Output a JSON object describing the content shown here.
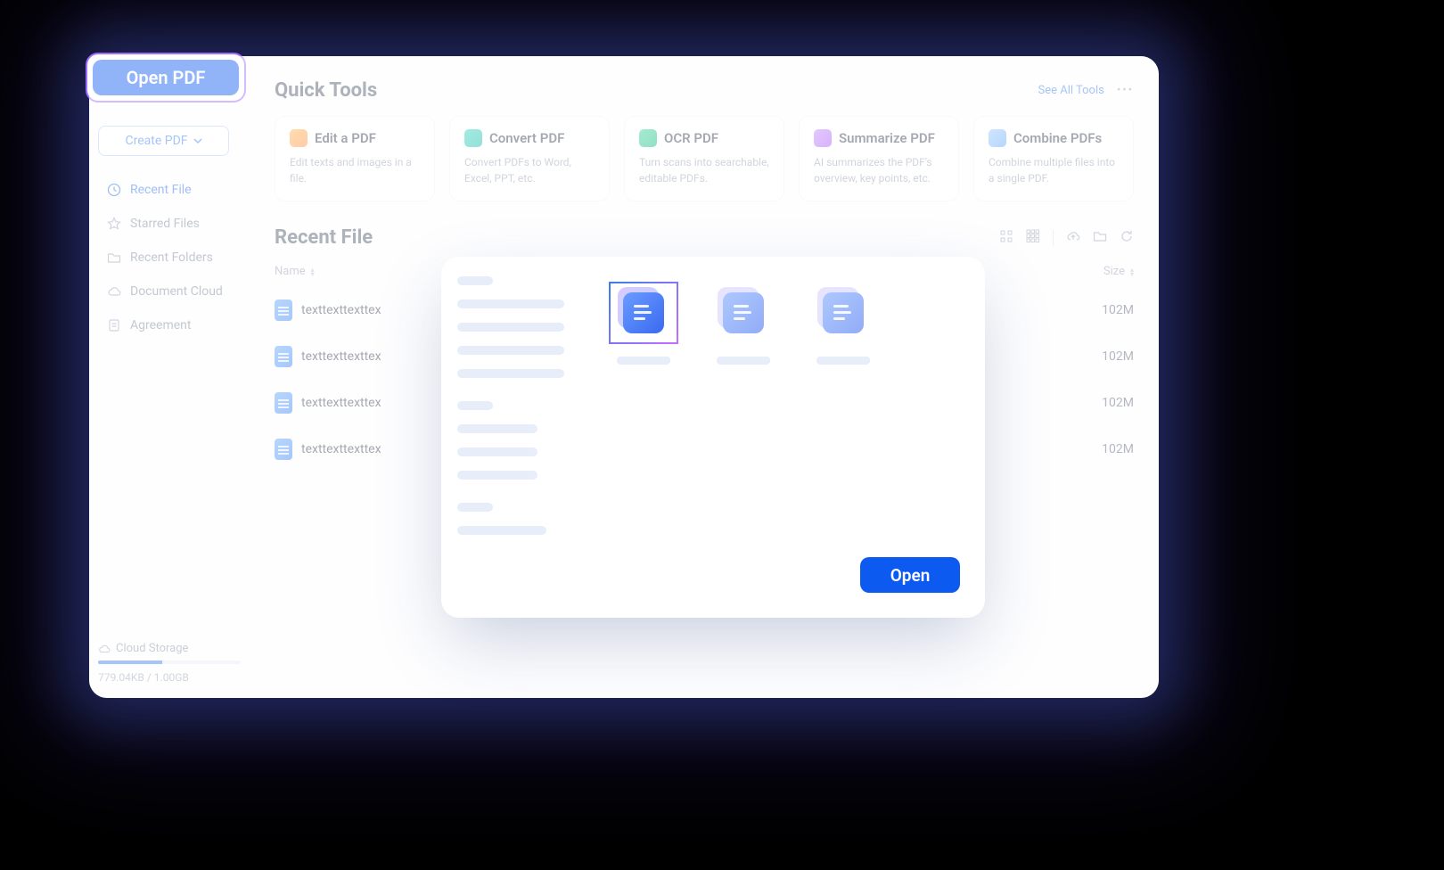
{
  "sidebar": {
    "open_pdf_label": "Open PDF",
    "create_pdf_label": "Create PDF",
    "nav": [
      {
        "icon": "clock",
        "label": "Recent File",
        "active": true
      },
      {
        "icon": "star",
        "label": "Starred Files",
        "active": false
      },
      {
        "icon": "folder",
        "label": "Recent Folders",
        "active": false
      },
      {
        "icon": "cloud",
        "label": "Document Cloud",
        "active": false
      },
      {
        "icon": "doc",
        "label": "Agreement",
        "active": false
      }
    ],
    "storage": {
      "label": "Cloud Storage",
      "usage_text": "779.04KB / 1.00GB"
    }
  },
  "quick_tools": {
    "title": "Quick Tools",
    "see_all_label": "See All Tools",
    "cards": [
      {
        "title": "Edit a PDF",
        "desc": "Edit texts and images in a file."
      },
      {
        "title": "Convert PDF",
        "desc": "Convert PDFs to Word, Excel, PPT, etc."
      },
      {
        "title": "OCR PDF",
        "desc": "Turn scans into searchable, editable PDFs."
      },
      {
        "title": "Summarize PDF",
        "desc": "AI summarizes the PDF's overview, key points, etc."
      },
      {
        "title": "Combine PDFs",
        "desc": "Combine multiple files into a single PDF."
      }
    ]
  },
  "recent": {
    "title": "Recent File",
    "col_name": "Name",
    "col_size": "Size",
    "rows": [
      {
        "name": "texttexttexttex",
        "size": "102M"
      },
      {
        "name": "texttexttexttex",
        "size": "102M"
      },
      {
        "name": "texttexttexttex",
        "size": "102M"
      },
      {
        "name": "texttexttexttex",
        "size": "102M"
      }
    ]
  },
  "picker": {
    "open_label": "Open"
  }
}
